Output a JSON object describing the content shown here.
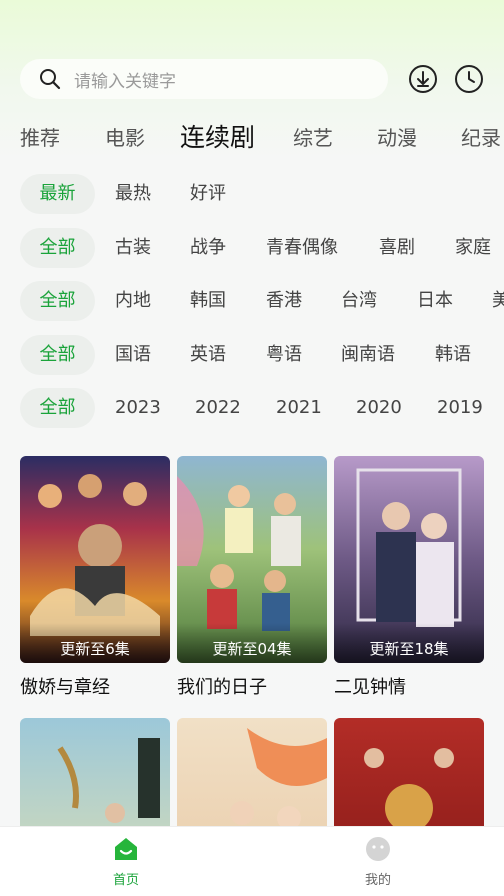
{
  "search": {
    "placeholder": "请输入关键字"
  },
  "header": {
    "download_icon": "download-icon",
    "history_icon": "clock-icon"
  },
  "category_tabs": [
    {
      "label": "推荐"
    },
    {
      "label": "电影"
    },
    {
      "label": "连续剧",
      "active": true
    },
    {
      "label": "综艺"
    },
    {
      "label": "动漫"
    },
    {
      "label": "纪录"
    }
  ],
  "filters": {
    "sort": [
      "最新",
      "最热",
      "好评"
    ],
    "genre": [
      "全部",
      "古装",
      "战争",
      "青春偶像",
      "喜剧",
      "家庭"
    ],
    "region": [
      "全部",
      "内地",
      "韩国",
      "香港",
      "台湾",
      "日本",
      "美"
    ],
    "language": [
      "全部",
      "国语",
      "英语",
      "粤语",
      "闽南语",
      "韩语"
    ],
    "year": [
      "全部",
      "2023",
      "2022",
      "2021",
      "2020",
      "2019"
    ]
  },
  "colors": {
    "accent": "#1aa33a",
    "chip_bg": "#ecefec"
  },
  "shows": [
    {
      "title": "傲娇与章经",
      "badge": "更新至6集",
      "poster_text": "傲娇与章经"
    },
    {
      "title": "我们的日子",
      "badge": "更新至04集",
      "poster_text": "我们的日子"
    },
    {
      "title": "二见钟情",
      "badge": "更新至18集",
      "poster_text": "二见钟情"
    },
    {
      "title": "",
      "badge": "",
      "poster_text": ""
    },
    {
      "title": "",
      "badge": "",
      "poster_text": ""
    },
    {
      "title": "",
      "badge": "",
      "poster_text": ""
    }
  ],
  "bottom_nav": [
    {
      "label": "首页",
      "icon": "home-icon",
      "active": true
    },
    {
      "label": "我的",
      "icon": "profile-icon",
      "active": false
    }
  ]
}
